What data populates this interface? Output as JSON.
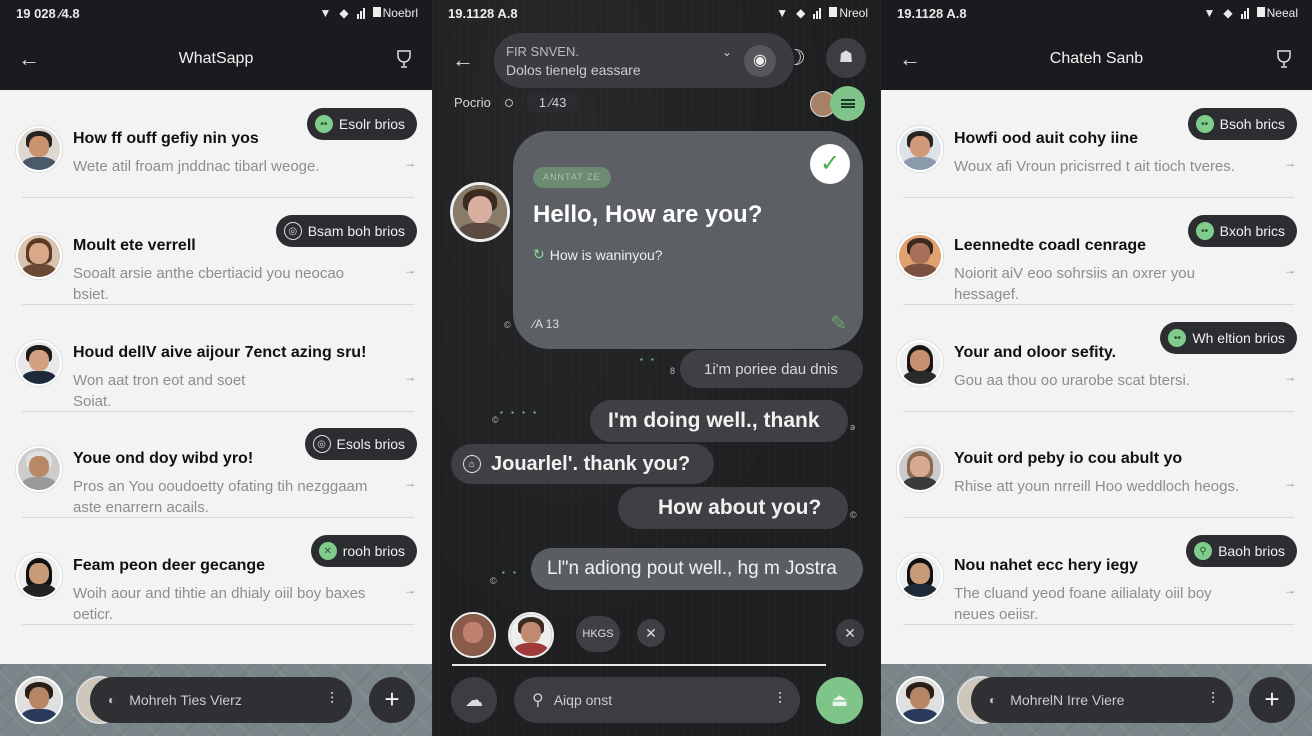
{
  "left": {
    "status": {
      "time": "19 028 ⁄4.8",
      "carrier": "Noebrl"
    },
    "header": {
      "title": "WhatSapp"
    },
    "chats": [
      {
        "name": "How ff ouff gefiy nin yos",
        "preview": "Wete atil froam jnddnac tibarl weoge.",
        "pill": "Esolr brios",
        "pill_icon": "dot"
      },
      {
        "name": "Moult ete verrell",
        "preview": "Sooalt arsie anthe cbertiacid you neocao bsiet.",
        "pill": "Bsam boh brios",
        "pill_icon": "ring"
      },
      {
        "name": "Houd dellV aive aijour 7enct azing sru!",
        "preview": "Won aat tron eot and soet Soiat.",
        "pill": "",
        "pill_icon": ""
      },
      {
        "name": "Youe ond doy wibd yro!",
        "preview": "Pros an You ooudoetty ofating tih nezggaam aste enarrern acails.",
        "pill": "Esols brios",
        "pill_icon": "ring"
      },
      {
        "name": "Feam peon deer gecange",
        "preview": "Woih aour and tihtie an dhialy oiil boy baxes oeticr.",
        "pill": "rooh brios",
        "pill_icon": "dot"
      }
    ],
    "bottom": {
      "search_text": "Mohreh Ties Vierz",
      "plus": "+"
    }
  },
  "middle": {
    "status": {
      "time": "19.1128 A.8",
      "carrier": "Nreol"
    },
    "header": {
      "line1": "FIR SNVEN.",
      "line2": "Dolos tienelg eassare"
    },
    "sub": {
      "label": "Pocrio",
      "chip": "1 ⁄43"
    },
    "card": {
      "tag": "ANNTAT ZE",
      "heading": "Hello, How are you?",
      "sub": "How is waninyou?",
      "time": "⁄A 13"
    },
    "bubbles": [
      "1i'm poriee dau dnis",
      "I'm doing well., thank",
      "Jouarlel'. thank you?",
      "How about you?",
      "Ll\"n adiong pout well., hg m Jostra"
    ],
    "strip": {
      "chip": "HKGS"
    },
    "compose": {
      "placeholder": "Aiqp onst"
    }
  },
  "right": {
    "status": {
      "time": "19.1128 A.8",
      "carrier": "Neeal"
    },
    "header": {
      "title": "Chateh Sanb"
    },
    "chats": [
      {
        "name": "Howfi ood auit cohy iine",
        "preview": "Woux afi Vroun pricisrred t ait tioch tveres.",
        "pill": "Bsoh brics",
        "pill_icon": "dot"
      },
      {
        "name": "Leennedte coadl cenrage",
        "preview": "Noiorit aiV eoo sohrsiis an oxrer you hessagef.",
        "pill": "Bxoh brics",
        "pill_icon": "dot"
      },
      {
        "name": "Your and oloor sefity.",
        "preview": "Gou aa thou oo urarobe scat btersi.",
        "pill": "Wh eltion brios",
        "pill_icon": "dot"
      },
      {
        "name": "Youit ord peby io cou abult yo",
        "preview": "Rhise att youn nrreill Hoo weddloch heogs.",
        "pill": "",
        "pill_icon": ""
      },
      {
        "name": "Nou nahet ecc hery iegy",
        "preview": "The cluand yeod foane ailialaty oiil boy neues oeiisr.",
        "pill": "Baoh brios",
        "pill_icon": "dot"
      }
    ],
    "bottom": {
      "search_text": "MohrelN Irre Viere",
      "plus": "+"
    }
  },
  "colors": {
    "accent_green": "#7fc489",
    "dark": "#1a1b1f",
    "pill": "#2b2d31",
    "list_bg": "#f3f3f3"
  }
}
